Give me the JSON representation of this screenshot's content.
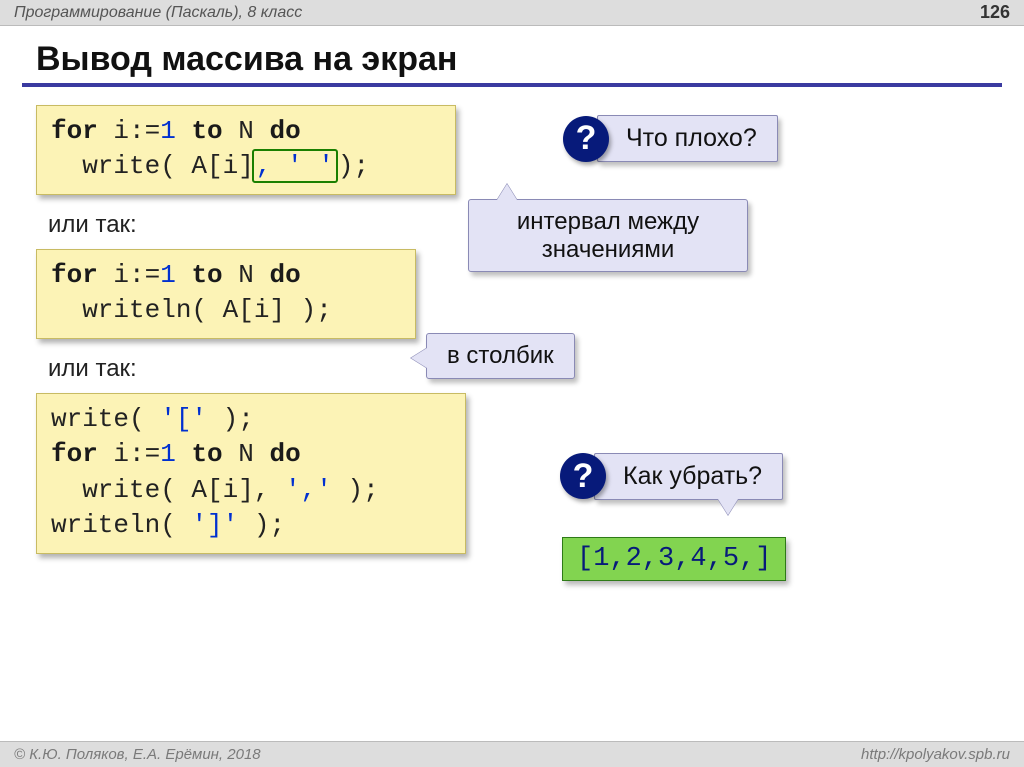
{
  "header": {
    "course": "Программирование (Паскаль), 8 класс",
    "page": "126"
  },
  "title": "Вывод массива на экран",
  "code1": {
    "l1_kw1": "for",
    "l1_tx1": " i:=",
    "l1_num": "1",
    "l1_kw2": " to",
    "l1_tx2": " N ",
    "l1_kw3": "do",
    "l2_tx1": "  write( A[i]",
    "l2_boxed": ", ' '",
    "l2_tx2": ");"
  },
  "or1": "или так:",
  "code2": {
    "l1_kw1": "for",
    "l1_tx1": " i:=",
    "l1_num": "1",
    "l1_kw2": " to",
    "l1_tx2": " N ",
    "l1_kw3": "do",
    "l2": "  writeln( A[i] );"
  },
  "or2": "или так:",
  "code3": {
    "l1a": "write( ",
    "l1s": "'['",
    "l1b": " );",
    "l2_kw1": "for",
    "l2_tx1": " i:=",
    "l2_num": "1",
    "l2_kw2": " to",
    "l2_tx2": " N ",
    "l2_kw3": "do",
    "l3a": "  write( A[i], ",
    "l3s": "','",
    "l3b": " );",
    "l4a": "writeln( ",
    "l4s": "']'",
    "l4b": " );"
  },
  "callouts": {
    "q1": "Что плохо?",
    "interval": "интервал между\nзначениями",
    "column": "в столбик",
    "q2": "Как убрать?"
  },
  "output": "[1,2,3,4,5,]",
  "footer": {
    "left": "© К.Ю. Поляков, Е.А. Ерёмин, 2018",
    "right": "http://kpolyakov.spb.ru"
  }
}
